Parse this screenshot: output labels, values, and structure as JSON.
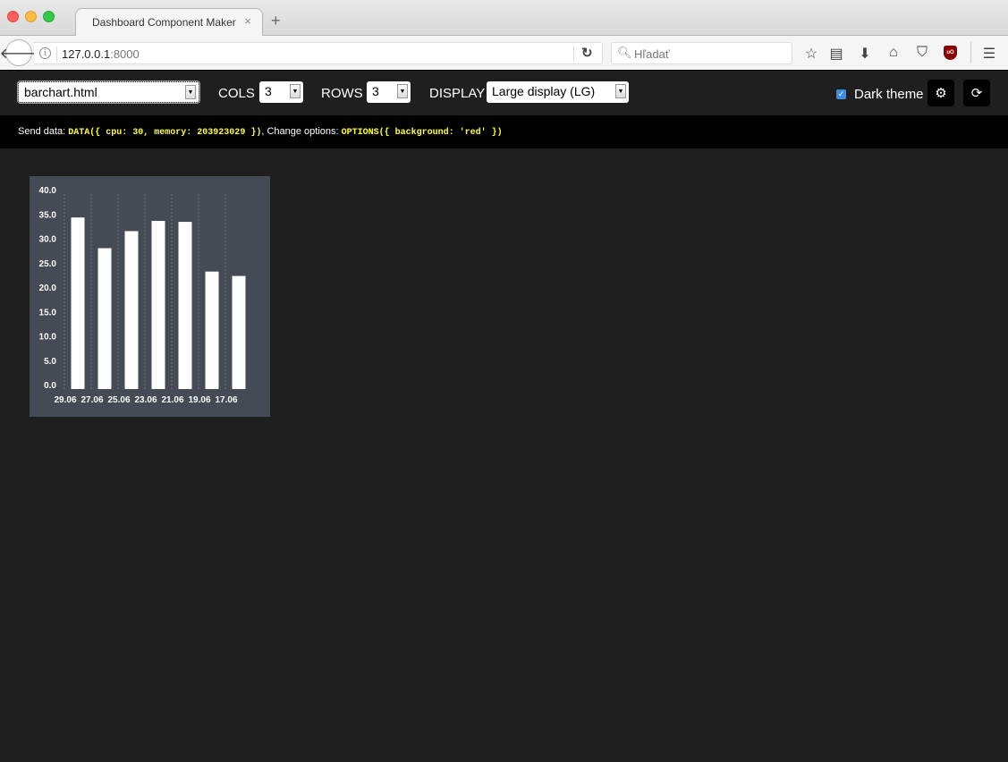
{
  "browser": {
    "tab_title": "Dashboard Component Maker",
    "tab_close": "×",
    "new_tab": "+",
    "url_host": "127.0.0.1",
    "url_port": ":8000",
    "search_placeholder": "Hľadať",
    "icons": [
      "back-icon",
      "info-icon",
      "reload-icon",
      "search-icon",
      "star-icon",
      "reading-list-icon",
      "download-icon",
      "home-icon",
      "pocket-icon",
      "ublock-icon",
      "menu-icon"
    ]
  },
  "toolbar": {
    "component_file": "barchart.html",
    "cols_label": "COLS",
    "cols_value": "3",
    "rows_label": "ROWS",
    "rows_value": "3",
    "display_label": "DISPLAY",
    "display_value": "Large display (LG)",
    "dark_theme_label": "Dark theme",
    "dark_theme_checked": true,
    "accent_color": "#3b8ee8"
  },
  "infobar": {
    "send_label": "Send data: ",
    "send_code": "DATA({ cpu: 30, memory: 203923029 })",
    "sep": ", Change options: ",
    "options_code": "OPTIONS({ background: 'red' })",
    "code_color": "#ffff3a"
  },
  "chart_data": {
    "type": "bar",
    "title": "",
    "xlabel": "",
    "ylabel": "",
    "categories": [
      "29.06",
      "27.06",
      "25.06",
      "23.06",
      "21.06",
      "19.06",
      "17.06"
    ],
    "values": [
      35.2,
      28.9,
      32.4,
      34.5,
      34.3,
      24.1,
      23.2
    ],
    "ylim": [
      0,
      40
    ],
    "yticks": [
      "0.0",
      "5.0",
      "10.0",
      "15.0",
      "20.0",
      "25.0",
      "30.0",
      "35.0",
      "40.0"
    ],
    "grid": "vertical-dotted",
    "background": "#454b54",
    "bar_color": "#ffffff"
  }
}
